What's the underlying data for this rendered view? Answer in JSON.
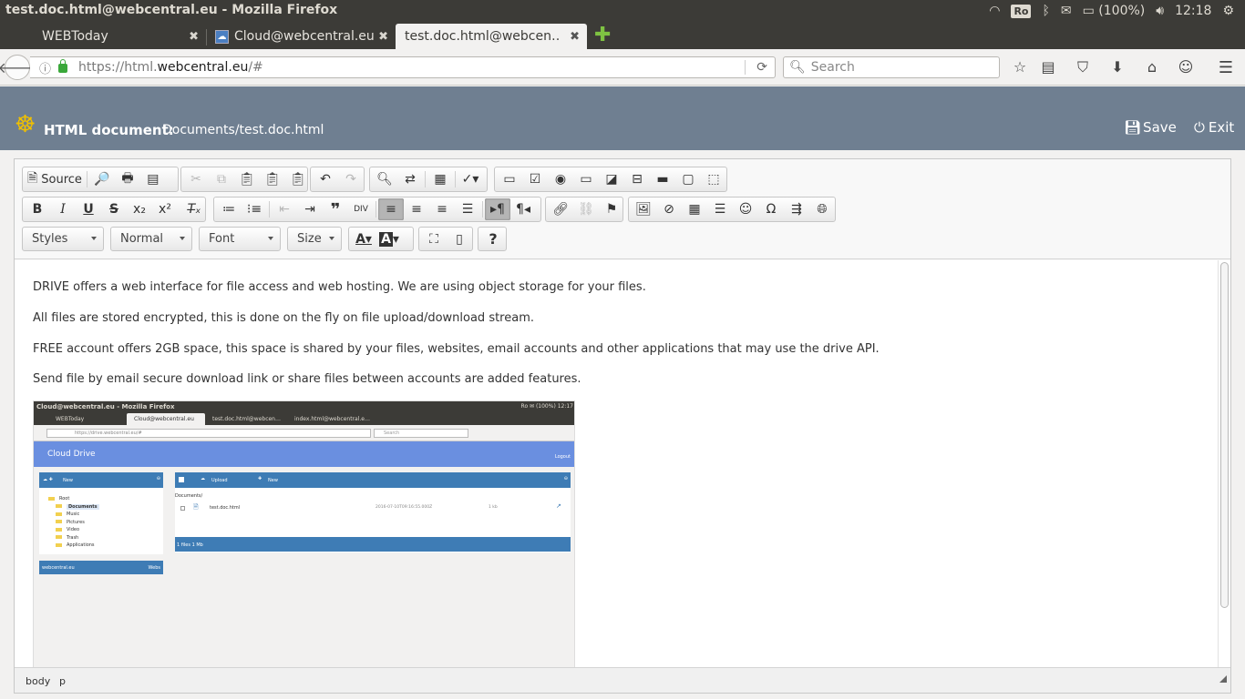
{
  "os": {
    "window_title": "test.doc.html@webcentral.eu - Mozilla Firefox",
    "keyboard_layout": "Ro",
    "battery": "(100%)",
    "clock": "12:18"
  },
  "browser": {
    "tabs": [
      {
        "label": "WEBToday",
        "close": "✖"
      },
      {
        "label": "Cloud@webcentral.eu",
        "close": "✖"
      },
      {
        "label": "test.doc.html@webcen…",
        "close": "✖"
      }
    ],
    "new_tab": "✚",
    "url_prefix": "https://html.",
    "url_domain": "webcentral.eu",
    "url_suffix": "/#",
    "search_placeholder": "Search"
  },
  "app": {
    "doc_label": "HTML document:",
    "doc_path": "Documents/test.doc.html",
    "save_label": "Save",
    "exit_label": "Exit"
  },
  "editor": {
    "source_label": "Source",
    "combos": {
      "styles": "Styles",
      "format": "Normal",
      "font": "Font",
      "size": "Size"
    },
    "paragraphs": [
      "DRIVE offers a web interface for file access and web hosting. We are using object storage for your files.",
      "All files are stored encrypted, this is done on the fly on file upload/download stream.",
      "FREE account offers 2GB space, this space is shared by your files, websites, email accounts and other applications that may use the drive API.",
      "Send file by email secure download link or share files between accounts are added features."
    ],
    "status_path": [
      "body",
      "p"
    ]
  },
  "embedded_screenshot": {
    "window_title": "Cloud@webcentral.eu - Mozilla Firefox",
    "tray": "Ro  ✉  (100%)  12:17",
    "tabs": [
      "WEBToday",
      "Cloud@webcentral.eu",
      "test.doc.html@webcen…",
      "index.html@webcentral.e…"
    ],
    "url": "https://drive.webcentral.eu/#",
    "search": "Search",
    "brand": "Cloud Drive",
    "logout": "Logout",
    "left_new": "New",
    "tree": [
      "Root",
      "Documents",
      "Music",
      "Pictures",
      "Video",
      "Trash",
      "Applications"
    ],
    "left_footer": "webcentral.eu",
    "left_footer_right": "Webs",
    "upload": "Upload",
    "right_new": "New",
    "breadcrumb": "Documents/",
    "file_name": "test.doc.html",
    "file_date": "2016-07-10T09:16:55.000Z",
    "file_size": "1 kb",
    "files_summary": "1 files 1 Mb"
  }
}
